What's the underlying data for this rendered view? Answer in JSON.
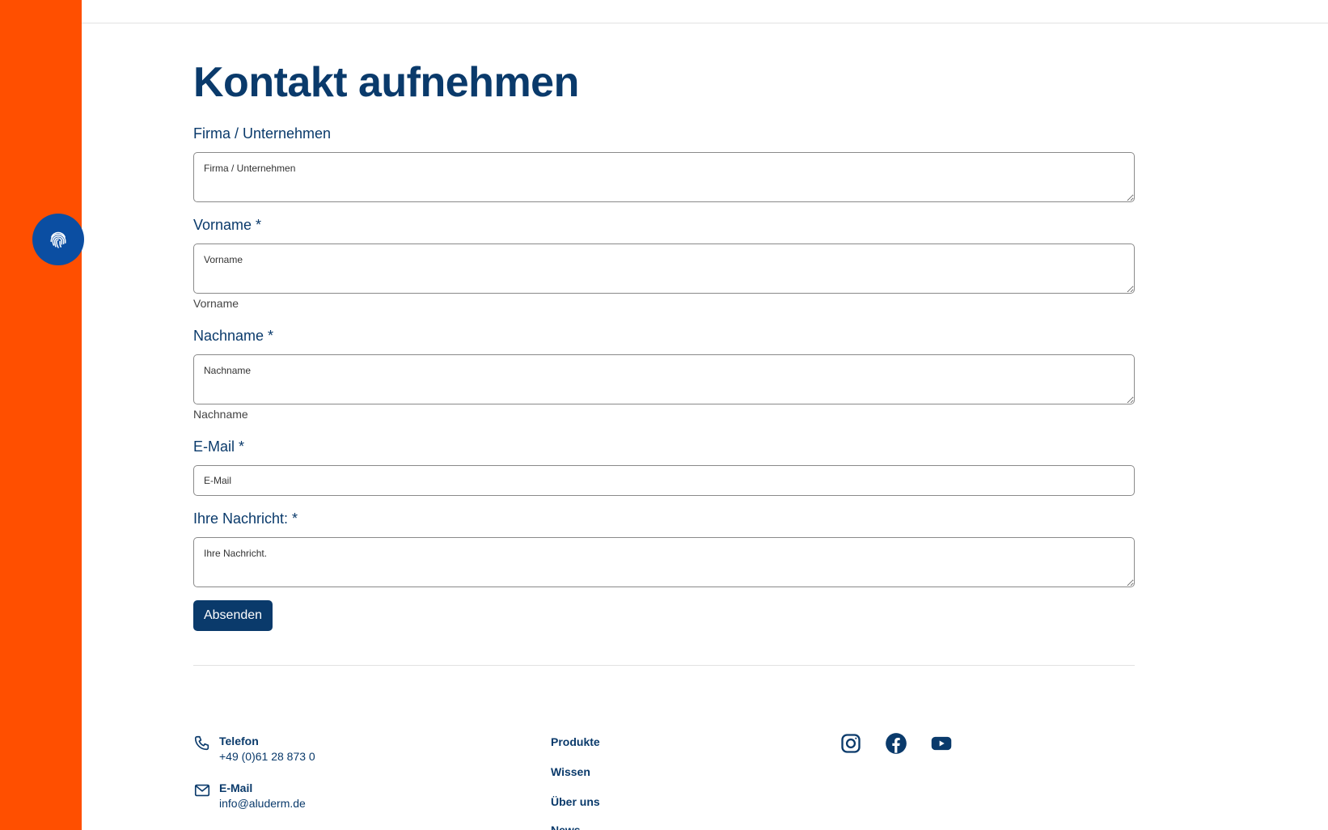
{
  "page": {
    "title": "Kontakt aufnehmen"
  },
  "form": {
    "company": {
      "label": "Firma / Unternehmen",
      "placeholder": "Firma / Unternehmen"
    },
    "firstname": {
      "label": "Vorname *",
      "placeholder": "Vorname",
      "helper": "Vorname"
    },
    "lastname": {
      "label": "Nachname *",
      "placeholder": "Nachname",
      "helper": "Nachname"
    },
    "email": {
      "label": "E-Mail *",
      "placeholder": "E-Mail"
    },
    "message": {
      "label": "Ihre Nachricht: *",
      "placeholder": "Ihre Nachricht."
    },
    "submit_label": "Absenden"
  },
  "footer": {
    "contacts": [
      {
        "title": "Telefon",
        "value": "+49 (0)61 28 873 0",
        "icon": "phone-icon"
      },
      {
        "title": "E-Mail",
        "value": "info@aluderm.de",
        "icon": "mail-icon"
      }
    ],
    "nav": [
      {
        "label": "Produkte"
      },
      {
        "label": "Wissen"
      },
      {
        "label": "Über uns"
      },
      {
        "label": "News"
      }
    ],
    "social": [
      "instagram-icon",
      "facebook-icon",
      "youtube-icon"
    ]
  },
  "colors": {
    "accent_orange": "#ff4f00",
    "brand_blue": "#0a3a6b",
    "fingerprint_button": "#0b4ea2"
  }
}
